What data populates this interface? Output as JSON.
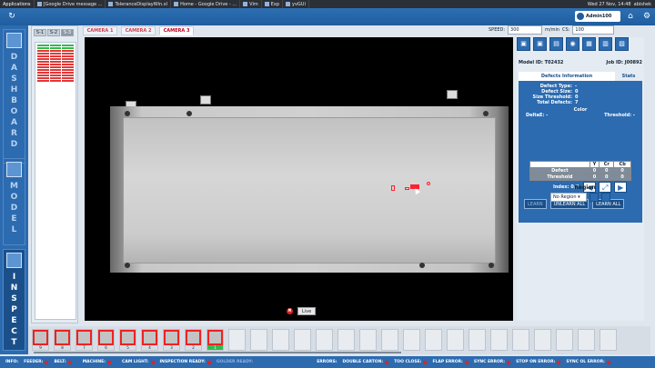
{
  "taskbar": {
    "apps_label": "Applications",
    "tasks": [
      "[Google Drive message ...",
      "ToleranceDisplayWin.xl",
      "Home - Google Drive - ...",
      "Vim",
      "Exp",
      "yvGUI"
    ],
    "clock": "Wed 27 Nov, 14:48",
    "user": "abishek"
  },
  "header": {
    "login_user": "Admin100",
    "icons": [
      "home-icon",
      "question-icon",
      "refresh-icon",
      "gear-icon"
    ]
  },
  "nav": {
    "dashboard": "DASHBOARD",
    "model": "MODEL",
    "inspect": "INSPECT"
  },
  "sensor_tabs": [
    "S-1",
    "S-2",
    "S-3"
  ],
  "sensor_colors": {
    "good": "#2ebd4c",
    "bad": "#e43838"
  },
  "camera_tabs": [
    "CAMERA 1",
    "CAMERA 2",
    "CAMERA 3"
  ],
  "speed": {
    "label": "SPEED:",
    "value": "300",
    "unit": "m/min",
    "cs_label": "CS:",
    "cs_value": "100"
  },
  "live": {
    "label": "Live",
    "close": "✖"
  },
  "ids": {
    "model_label": "Model ID:",
    "model_value": "T02432",
    "job_label": "Job ID:",
    "job_value": "J00892"
  },
  "defects": {
    "tab_info": "Defects Information",
    "tab_stats": "Stats",
    "rows": [
      {
        "k": "Defect Type:",
        "v": "-"
      },
      {
        "k": "Defect Size:",
        "v": "0"
      },
      {
        "k": "Size Threshold:",
        "v": "0"
      },
      {
        "k": "Total Defects:",
        "v": "7"
      }
    ],
    "color_title": "Color",
    "deltae_label": "DeltaE: -",
    "threshold_label": "Threshold: -",
    "table_headers": [
      "",
      "Y",
      "Cr",
      "Cb"
    ],
    "table_rows": [
      {
        "label": "Defect",
        "y": "0",
        "cr": "0",
        "cb": "0"
      },
      {
        "label": "Threshold",
        "y": "0",
        "cr": "0",
        "cb": "0"
      }
    ],
    "index_label": "Index: 0/7",
    "learn": "LEARN",
    "unlearn_all": "UNLEARN ALL",
    "learn_all": "LEARN ALL"
  },
  "region": {
    "title": "Region",
    "selected": "No Region"
  },
  "thumbnails": [
    "9",
    "8",
    "7",
    "6",
    "5",
    "4",
    "3",
    "2",
    "1"
  ],
  "status": {
    "items": [
      {
        "label": "INFO:"
      },
      {
        "label": "FEEDER:"
      },
      {
        "label": "BELT:"
      },
      {
        "label": "MACHINE:"
      },
      {
        "label": "CAM LIGHT:"
      },
      {
        "label": "INSPECTION READY:"
      },
      {
        "label": "GOLDER READY:"
      },
      {
        "label": "ERRORS:"
      },
      {
        "label": "DOUBLE CARTON:"
      },
      {
        "label": "TOO CLOSE:"
      },
      {
        "label": "FLAP ERROR:"
      },
      {
        "label": "SYNC ERROR:"
      },
      {
        "label": "STOP ON ERROR:"
      },
      {
        "label": "SYNC OL ERROR:"
      }
    ]
  }
}
